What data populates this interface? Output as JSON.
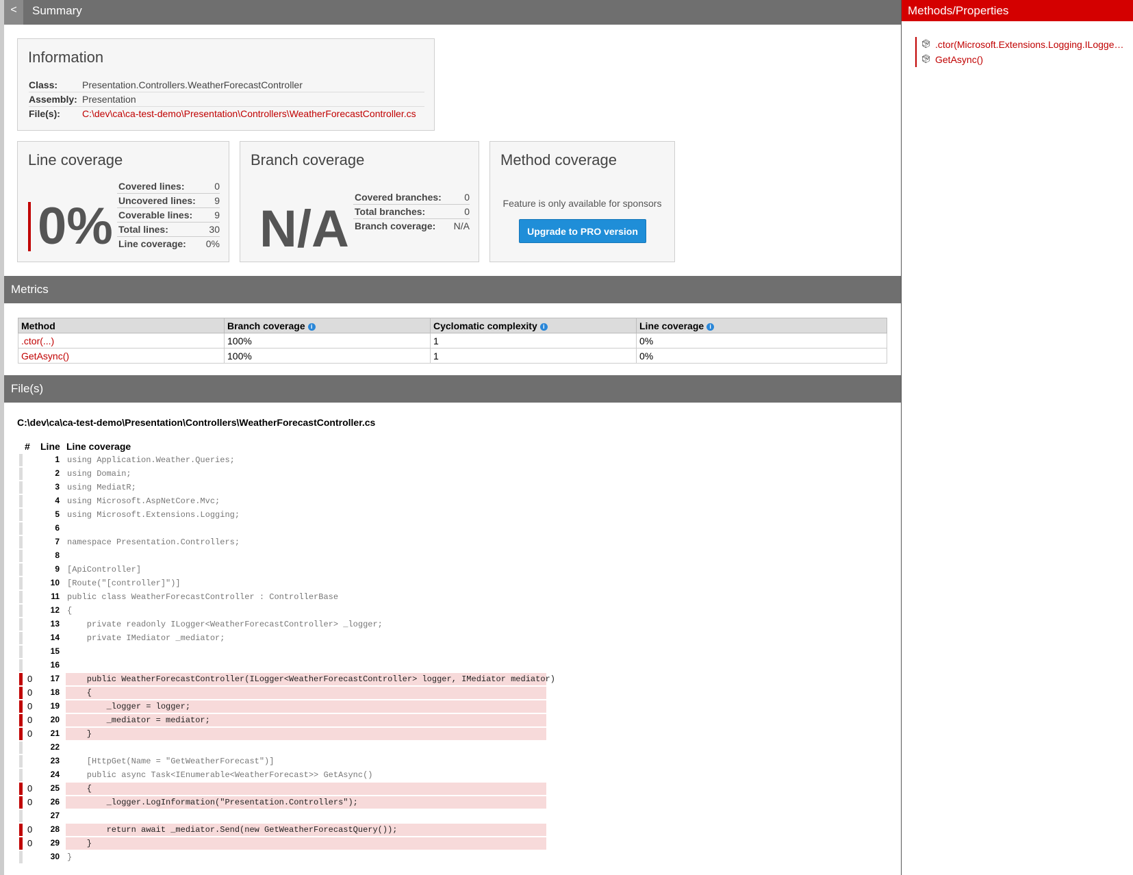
{
  "header": {
    "back_label": "<",
    "title": "Summary"
  },
  "information": {
    "title": "Information",
    "rows": [
      {
        "key": "Class:",
        "value": "Presentation.Controllers.WeatherForecastController"
      },
      {
        "key": "Assembly:",
        "value": "Presentation"
      },
      {
        "key": "File(s):",
        "value": "C:\\dev\\ca\\ca-test-demo\\Presentation\\Controllers\\WeatherForecastController.cs"
      }
    ]
  },
  "line_coverage": {
    "title": "Line coverage",
    "big_value": "0%",
    "percent": 0,
    "stats": [
      {
        "key": "Covered lines:",
        "value": "0"
      },
      {
        "key": "Uncovered lines:",
        "value": "9"
      },
      {
        "key": "Coverable lines:",
        "value": "9"
      },
      {
        "key": "Total lines:",
        "value": "30"
      },
      {
        "key": "Line coverage:",
        "value": "0%"
      }
    ]
  },
  "branch_coverage": {
    "title": "Branch coverage",
    "big_value": "N/A",
    "stats": [
      {
        "key": "Covered branches:",
        "value": "0"
      },
      {
        "key": "Total branches:",
        "value": "0"
      },
      {
        "key": "Branch coverage:",
        "value": "N/A"
      }
    ]
  },
  "method_coverage": {
    "title": "Method coverage",
    "sponsor_text": "Feature is only available for sponsors",
    "button_label": "Upgrade to PRO version",
    "button_color": "#1f8ed8"
  },
  "metrics": {
    "title": "Metrics",
    "info_icon": "info-icon",
    "columns": [
      "Method",
      "Branch coverage",
      "Cyclomatic complexity",
      "Line coverage"
    ],
    "rows": [
      {
        "method": ".ctor(...)",
        "branch": "100%",
        "cyclomatic": "1",
        "line": "0%"
      },
      {
        "method": "GetAsync()",
        "branch": "100%",
        "cyclomatic": "1",
        "line": "0%"
      }
    ]
  },
  "files": {
    "title": "File(s)",
    "path": "C:\\dev\\ca\\ca-test-demo\\Presentation\\Controllers\\WeatherForecastController.cs",
    "columns": {
      "hash": "#",
      "line": "Line",
      "coverage": "Line coverage"
    },
    "lines": [
      {
        "n": "1",
        "hits": "",
        "src": "using Application.Weather.Queries;"
      },
      {
        "n": "2",
        "hits": "",
        "src": "using Domain;"
      },
      {
        "n": "3",
        "hits": "",
        "src": "using MediatR;"
      },
      {
        "n": "4",
        "hits": "",
        "src": "using Microsoft.AspNetCore.Mvc;"
      },
      {
        "n": "5",
        "hits": "",
        "src": "using Microsoft.Extensions.Logging;"
      },
      {
        "n": "6",
        "hits": "",
        "src": ""
      },
      {
        "n": "7",
        "hits": "",
        "src": "namespace Presentation.Controllers;"
      },
      {
        "n": "8",
        "hits": "",
        "src": ""
      },
      {
        "n": "9",
        "hits": "",
        "src": "[ApiController]"
      },
      {
        "n": "10",
        "hits": "",
        "src": "[Route(\"[controller]\")]"
      },
      {
        "n": "11",
        "hits": "",
        "src": "public class WeatherForecastController : ControllerBase"
      },
      {
        "n": "12",
        "hits": "",
        "src": "{"
      },
      {
        "n": "13",
        "hits": "",
        "src": "    private readonly ILogger<WeatherForecastController> _logger;"
      },
      {
        "n": "14",
        "hits": "",
        "src": "    private IMediator _mediator;"
      },
      {
        "n": "15",
        "hits": "",
        "src": ""
      },
      {
        "n": "16",
        "hits": "",
        "src": ""
      },
      {
        "n": "17",
        "hits": "0",
        "src": "    public WeatherForecastController(ILogger<WeatherForecastController> logger, IMediator mediator)"
      },
      {
        "n": "18",
        "hits": "0",
        "src": "    {"
      },
      {
        "n": "19",
        "hits": "0",
        "src": "        _logger = logger;"
      },
      {
        "n": "20",
        "hits": "0",
        "src": "        _mediator = mediator;"
      },
      {
        "n": "21",
        "hits": "0",
        "src": "    }"
      },
      {
        "n": "22",
        "hits": "",
        "src": ""
      },
      {
        "n": "23",
        "hits": "",
        "src": "    [HttpGet(Name = \"GetWeatherForecast\")]"
      },
      {
        "n": "24",
        "hits": "",
        "src": "    public async Task<IEnumerable<WeatherForecast>> GetAsync()"
      },
      {
        "n": "25",
        "hits": "0",
        "src": "    {"
      },
      {
        "n": "26",
        "hits": "0",
        "src": "        _logger.LogInformation(\"Presentation.Controllers\");"
      },
      {
        "n": "27",
        "hits": "",
        "src": ""
      },
      {
        "n": "28",
        "hits": "0",
        "src": "        return await _mediator.Send(new GetWeatherForecastQuery());"
      },
      {
        "n": "29",
        "hits": "0",
        "src": "    }"
      },
      {
        "n": "30",
        "hits": "",
        "src": "}"
      }
    ]
  },
  "sidebar": {
    "title": "Methods/Properties",
    "item_icon": "cube-icon",
    "items": [
      {
        "label": ".ctor(Microsoft.Extensions.Logging.ILogger<Presentation.Controllers.WeatherForecastController>,MediatR.IMediator)"
      },
      {
        "label": "GetAsync()"
      }
    ]
  },
  "colors": {
    "accent": "#c00000",
    "header_gray": "#6f6f6f",
    "uncovered_bg": "#f7dada",
    "sidebar_header": "#d40000"
  }
}
